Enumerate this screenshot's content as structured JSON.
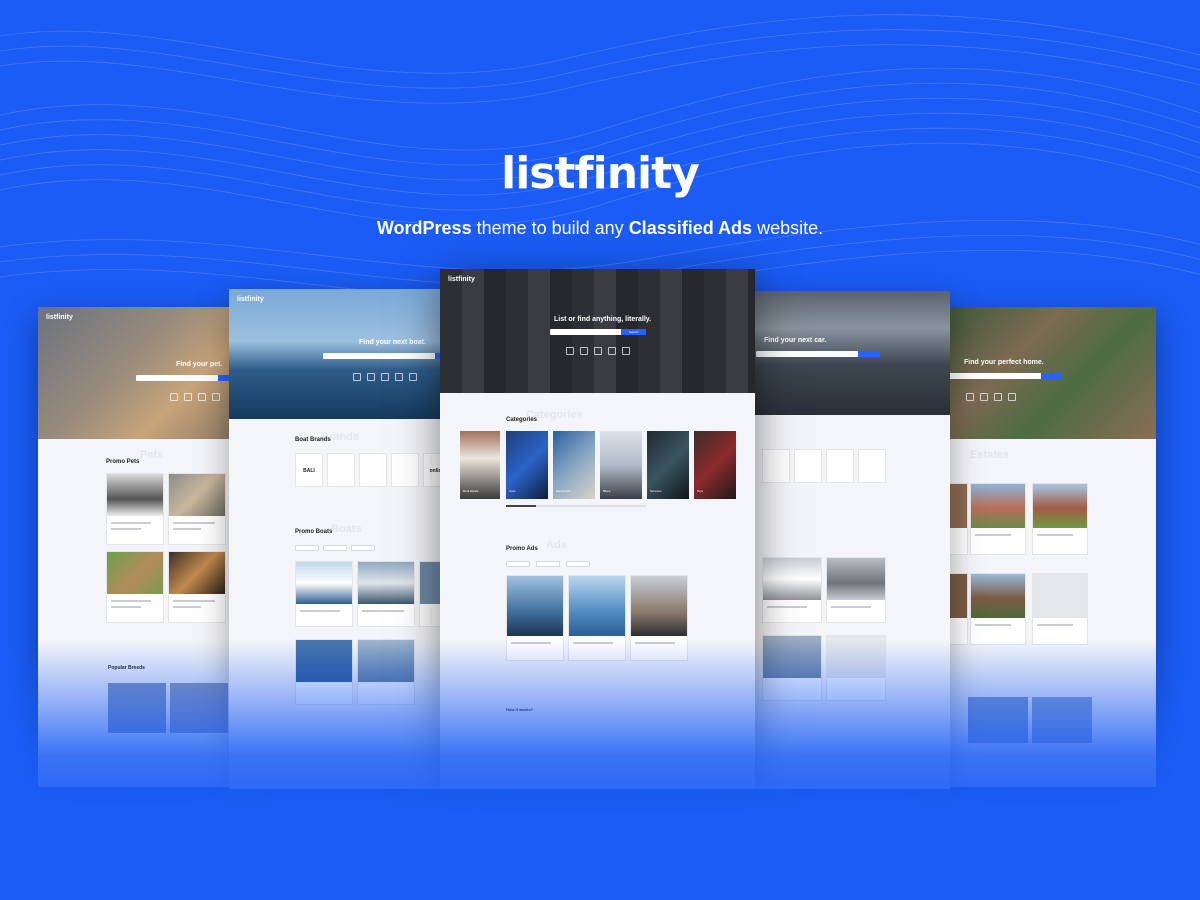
{
  "brand": {
    "logo": "listfinity",
    "tagline_pre": "WordPress",
    "tagline_mid": " theme to build any ",
    "tagline_bold": "Classified Ads",
    "tagline_post": " website."
  },
  "colors": {
    "background": "#1a5cf5",
    "accent": "#2563ff",
    "sale": "#e53935"
  },
  "screens": {
    "pets": {
      "hero_title": "Find your pet.",
      "section_promo": "Promo Pets",
      "section_breeds": "Popular Breeds",
      "ghost": "Pets"
    },
    "boats": {
      "hero_title": "Find your next boat.",
      "section_brands": "Boat Brands",
      "section_promo": "Promo Boats",
      "ghost_brands": "Brands",
      "ghost_promo": "Boats",
      "brands": [
        "BALI",
        "",
        "",
        "",
        "online"
      ]
    },
    "main": {
      "hero_title": "List or find anything, literally.",
      "search_button": "Search",
      "section_categories": "Categories",
      "section_promo": "Promo Ads",
      "section_how": "How it works?",
      "ghost": "Categories",
      "ghost_promo": "Ads",
      "categories": [
        "Real Estate",
        "Cars",
        "Electronics",
        "Bikes",
        "Services",
        "Toys"
      ]
    },
    "cars": {
      "hero_title": "Find your next car."
    },
    "homes": {
      "hero_title": "Find your perfect home.",
      "ghost": "Estates"
    }
  }
}
